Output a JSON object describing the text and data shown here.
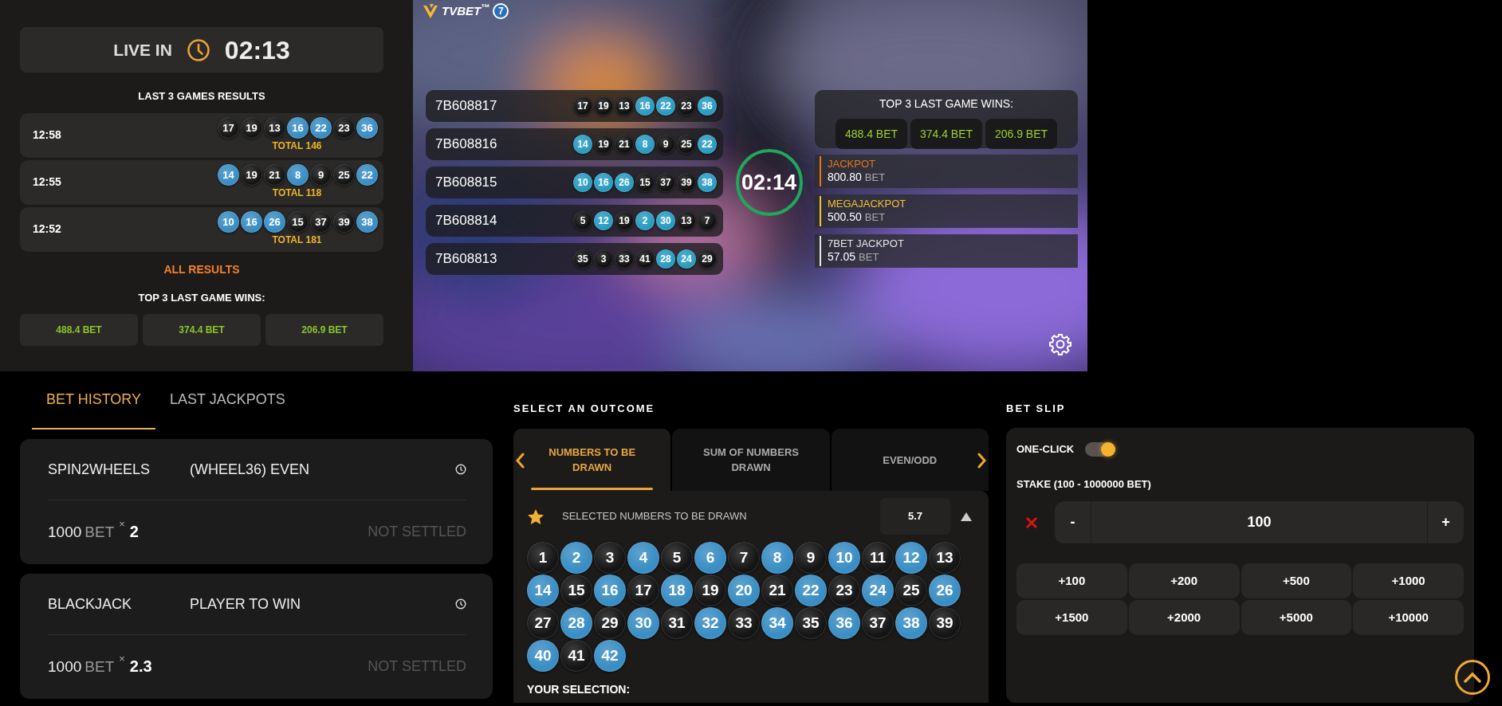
{
  "countdown": {
    "label": "LIVE IN",
    "time": "02:13"
  },
  "last_results": {
    "title": "LAST 3 GAMES RESULTS",
    "rows": [
      {
        "time": "12:58",
        "total": "TOTAL 146",
        "balls": [
          {
            "n": "17",
            "color": "#151515"
          },
          {
            "n": "19",
            "color": "#151515"
          },
          {
            "n": "13",
            "color": "#151515"
          },
          {
            "n": "16",
            "color": "#3a8ec4"
          },
          {
            "n": "22",
            "color": "#3a8ec4"
          },
          {
            "n": "23",
            "color": "#151515"
          },
          {
            "n": "36",
            "color": "#3a8ec4"
          }
        ]
      },
      {
        "time": "12:55",
        "total": "TOTAL 118",
        "balls": [
          {
            "n": "14",
            "color": "#3a8ec4"
          },
          {
            "n": "19",
            "color": "#151515"
          },
          {
            "n": "21",
            "color": "#151515"
          },
          {
            "n": "8",
            "color": "#3a8ec4"
          },
          {
            "n": "9",
            "color": "#151515"
          },
          {
            "n": "25",
            "color": "#151515"
          },
          {
            "n": "22",
            "color": "#3a8ec4"
          }
        ]
      },
      {
        "time": "12:52",
        "total": "TOTAL 181",
        "balls": [
          {
            "n": "10",
            "color": "#3a8ec4"
          },
          {
            "n": "16",
            "color": "#3a8ec4"
          },
          {
            "n": "26",
            "color": "#3a8ec4"
          },
          {
            "n": "15",
            "color": "#151515"
          },
          {
            "n": "37",
            "color": "#151515"
          },
          {
            "n": "39",
            "color": "#151515"
          },
          {
            "n": "38",
            "color": "#3a8ec4"
          }
        ]
      }
    ],
    "link": "ALL RESULTS"
  },
  "top_wins": {
    "title": "TOP 3 LAST GAME WINS:",
    "amounts": [
      "488.4 BET",
      "374.4 BET",
      "206.9 BET"
    ]
  },
  "video": {
    "logo": {
      "name": "TVBET$^{™}$",
      "badge": "7"
    },
    "draws": [
      {
        "id": "7B608817",
        "balls": [
          {
            "n": "17",
            "color": "#111111"
          },
          {
            "n": "19",
            "color": "#111111"
          },
          {
            "n": "13",
            "color": "#111111"
          },
          {
            "n": "16",
            "color": "#2a9cc2"
          },
          {
            "n": "22",
            "color": "#2a9cc2"
          },
          {
            "n": "23",
            "color": "#111111"
          },
          {
            "n": "36",
            "color": "#2a9cc2"
          }
        ]
      },
      {
        "id": "7B608816",
        "balls": [
          {
            "n": "14",
            "color": "#2a9cc2"
          },
          {
            "n": "19",
            "color": "#111111"
          },
          {
            "n": "21",
            "color": "#111111"
          },
          {
            "n": "8",
            "color": "#2a9cc2"
          },
          {
            "n": "9",
            "color": "#111111"
          },
          {
            "n": "25",
            "color": "#111111"
          },
          {
            "n": "22",
            "color": "#2a9cc2"
          }
        ]
      },
      {
        "id": "7B608815",
        "balls": [
          {
            "n": "10",
            "color": "#2a9cc2"
          },
          {
            "n": "16",
            "color": "#2a9cc2"
          },
          {
            "n": "26",
            "color": "#2a9cc2"
          },
          {
            "n": "15",
            "color": "#111111"
          },
          {
            "n": "37",
            "color": "#111111"
          },
          {
            "n": "39",
            "color": "#111111"
          },
          {
            "n": "38",
            "color": "#2a9cc2"
          }
        ]
      },
      {
        "id": "7B608814",
        "balls": [
          {
            "n": "5",
            "color": "#111111"
          },
          {
            "n": "12",
            "color": "#2a9cc2"
          },
          {
            "n": "19",
            "color": "#111111"
          },
          {
            "n": "2",
            "color": "#2a9cc2"
          },
          {
            "n": "30",
            "color": "#2a9cc2"
          },
          {
            "n": "13",
            "color": "#111111"
          },
          {
            "n": "7",
            "color": "#111111"
          }
        ]
      },
      {
        "id": "7B608813",
        "balls": [
          {
            "n": "35",
            "color": "#111111"
          },
          {
            "n": "3",
            "color": "#111111"
          },
          {
            "n": "33",
            "color": "#111111"
          },
          {
            "n": "41",
            "color": "#111111"
          },
          {
            "n": "28",
            "color": "#2a9cc2"
          },
          {
            "n": "24",
            "color": "#2a9cc2"
          },
          {
            "n": "29",
            "color": "#111111"
          }
        ]
      }
    ],
    "timer": "02:14",
    "top_wins": {
      "title": "TOP 3 LAST GAME WINS:",
      "amounts": [
        "488.4 BET",
        "374.4 BET",
        "206.9 BET"
      ]
    },
    "jackpots": [
      {
        "name": "JACKPOT",
        "amount": "800.80",
        "unit": "BET",
        "color": "#e8751a"
      },
      {
        "name": "MEGAJACKPOT",
        "amount": "500.50",
        "unit": "BET",
        "color": "#f1c232"
      },
      {
        "name": "7BET JACKPOT",
        "amount": "57.05",
        "unit": "BET",
        "color": "#e6e6e6"
      }
    ]
  },
  "history": {
    "tabs": [
      {
        "label": "BET HISTORY",
        "selected": true
      },
      {
        "label": "LAST JACKPOTS",
        "selected": false
      }
    ],
    "bets": [
      {
        "game": "SPIN2WHEELS",
        "outcome": "(WHEEL36) EVEN",
        "stake": "1000",
        "unit": "BET",
        "times": "×",
        "odds": "2",
        "status": "NOT SETTLED"
      },
      {
        "game": "BLACKJACK",
        "outcome": "PLAYER TO WIN",
        "stake": "1000",
        "unit": "BET",
        "times": "×",
        "odds": "2.3",
        "status": "NOT SETTLED"
      }
    ]
  },
  "outcome": {
    "title": "SELECT AN OUTCOME",
    "tabs": [
      {
        "label": "NUMBERS TO BE DRAWN",
        "selected": true
      },
      {
        "label": "SUM OF NUMBERS DRAWN",
        "selected": false
      },
      {
        "label": "EVEN/ODD",
        "selected": false
      }
    ],
    "market": {
      "name": "SELECTED NUMBERS TO BE DRAWN",
      "odds": "5.7"
    },
    "numbers": [
      {
        "n": "1",
        "color": "#151515"
      },
      {
        "n": "2",
        "color": "#3a8ec4"
      },
      {
        "n": "3",
        "color": "#151515"
      },
      {
        "n": "4",
        "color": "#3a8ec4"
      },
      {
        "n": "5",
        "color": "#151515"
      },
      {
        "n": "6",
        "color": "#3a8ec4"
      },
      {
        "n": "7",
        "color": "#151515"
      },
      {
        "n": "8",
        "color": "#3a8ec4"
      },
      {
        "n": "9",
        "color": "#151515"
      },
      {
        "n": "10",
        "color": "#3a8ec4"
      },
      {
        "n": "11",
        "color": "#151515"
      },
      {
        "n": "12",
        "color": "#3a8ec4"
      },
      {
        "n": "13",
        "color": "#151515"
      },
      {
        "n": "14",
        "color": "#3a8ec4"
      },
      {
        "n": "15",
        "color": "#151515"
      },
      {
        "n": "16",
        "color": "#3a8ec4"
      },
      {
        "n": "17",
        "color": "#151515"
      },
      {
        "n": "18",
        "color": "#3a8ec4"
      },
      {
        "n": "19",
        "color": "#151515"
      },
      {
        "n": "20",
        "color": "#3a8ec4"
      },
      {
        "n": "21",
        "color": "#151515"
      },
      {
        "n": "22",
        "color": "#3a8ec4"
      },
      {
        "n": "23",
        "color": "#151515"
      },
      {
        "n": "24",
        "color": "#3a8ec4"
      },
      {
        "n": "25",
        "color": "#151515"
      },
      {
        "n": "26",
        "color": "#3a8ec4"
      },
      {
        "n": "27",
        "color": "#151515"
      },
      {
        "n": "28",
        "color": "#3a8ec4"
      },
      {
        "n": "29",
        "color": "#151515"
      },
      {
        "n": "30",
        "color": "#3a8ec4"
      },
      {
        "n": "31",
        "color": "#151515"
      },
      {
        "n": "32",
        "color": "#3a8ec4"
      },
      {
        "n": "33",
        "color": "#151515"
      },
      {
        "n": "34",
        "color": "#3a8ec4"
      },
      {
        "n": "35",
        "color": "#151515"
      },
      {
        "n": "36",
        "color": "#3a8ec4"
      },
      {
        "n": "37",
        "color": "#151515"
      },
      {
        "n": "38",
        "color": "#3a8ec4"
      },
      {
        "n": "39",
        "color": "#151515"
      },
      {
        "n": "40",
        "color": "#3a8ec4"
      },
      {
        "n": "41",
        "color": "#151515"
      },
      {
        "n": "42",
        "color": "#3a8ec4"
      }
    ],
    "your_selection": "YOUR SELECTION:"
  },
  "bet_slip": {
    "title": "BET SLIP",
    "one_click": {
      "label": "ONE-CLICK",
      "on": true
    },
    "stake_label": "STAKE (100 - 1000000 BET)",
    "minus": "-",
    "value": "100",
    "plus": "+",
    "quick": [
      "+100",
      "+200",
      "+500",
      "+1000",
      "+1500",
      "+2000",
      "+5000",
      "+10000"
    ]
  }
}
